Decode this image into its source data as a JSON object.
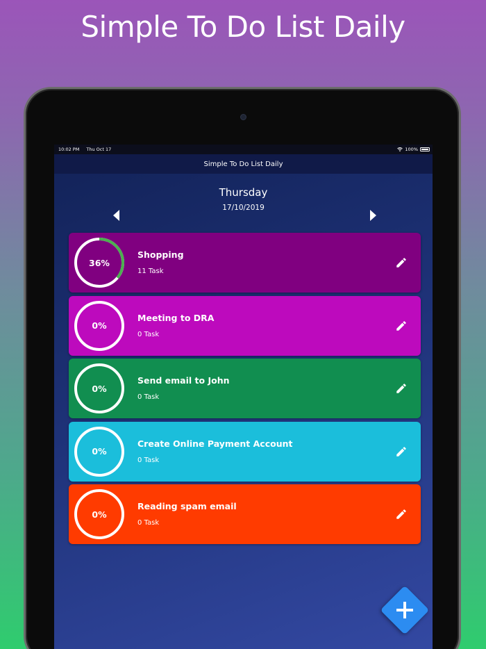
{
  "promo": {
    "title": "Simple To Do List Daily"
  },
  "status_bar": {
    "time": "10:02 PM",
    "date": "Thu Oct 17",
    "battery": "100%"
  },
  "nav": {
    "title": "Simple To Do List Daily"
  },
  "day": {
    "name": "Thursday",
    "date": "17/10/2019"
  },
  "icons": {
    "prev": "triangle-left-icon",
    "next": "triangle-right-icon",
    "edit": "pencil-icon",
    "add": "plus-icon"
  },
  "tasks": [
    {
      "title": "Shopping",
      "count": "11 Task",
      "progress": "36%",
      "progress_value": 0.36,
      "color": "#800080"
    },
    {
      "title": "Meeting to DRA",
      "count": "0 Task",
      "progress": "0%",
      "progress_value": 0,
      "color": "#bd0abd"
    },
    {
      "title": "Send email to John",
      "count": "0 Task",
      "progress": "0%",
      "progress_value": 0,
      "color": "#118e50"
    },
    {
      "title": "Create Online Payment Account",
      "count": "0 Task",
      "progress": "0%",
      "progress_value": 0,
      "color": "#1bbedb"
    },
    {
      "title": "Reading spam email",
      "count": "0 Task",
      "progress": "0%",
      "progress_value": 0,
      "color": "#ff3b00"
    }
  ],
  "colors": {
    "progress_ring": "#4caf50",
    "fab": "#2c8cf1"
  }
}
